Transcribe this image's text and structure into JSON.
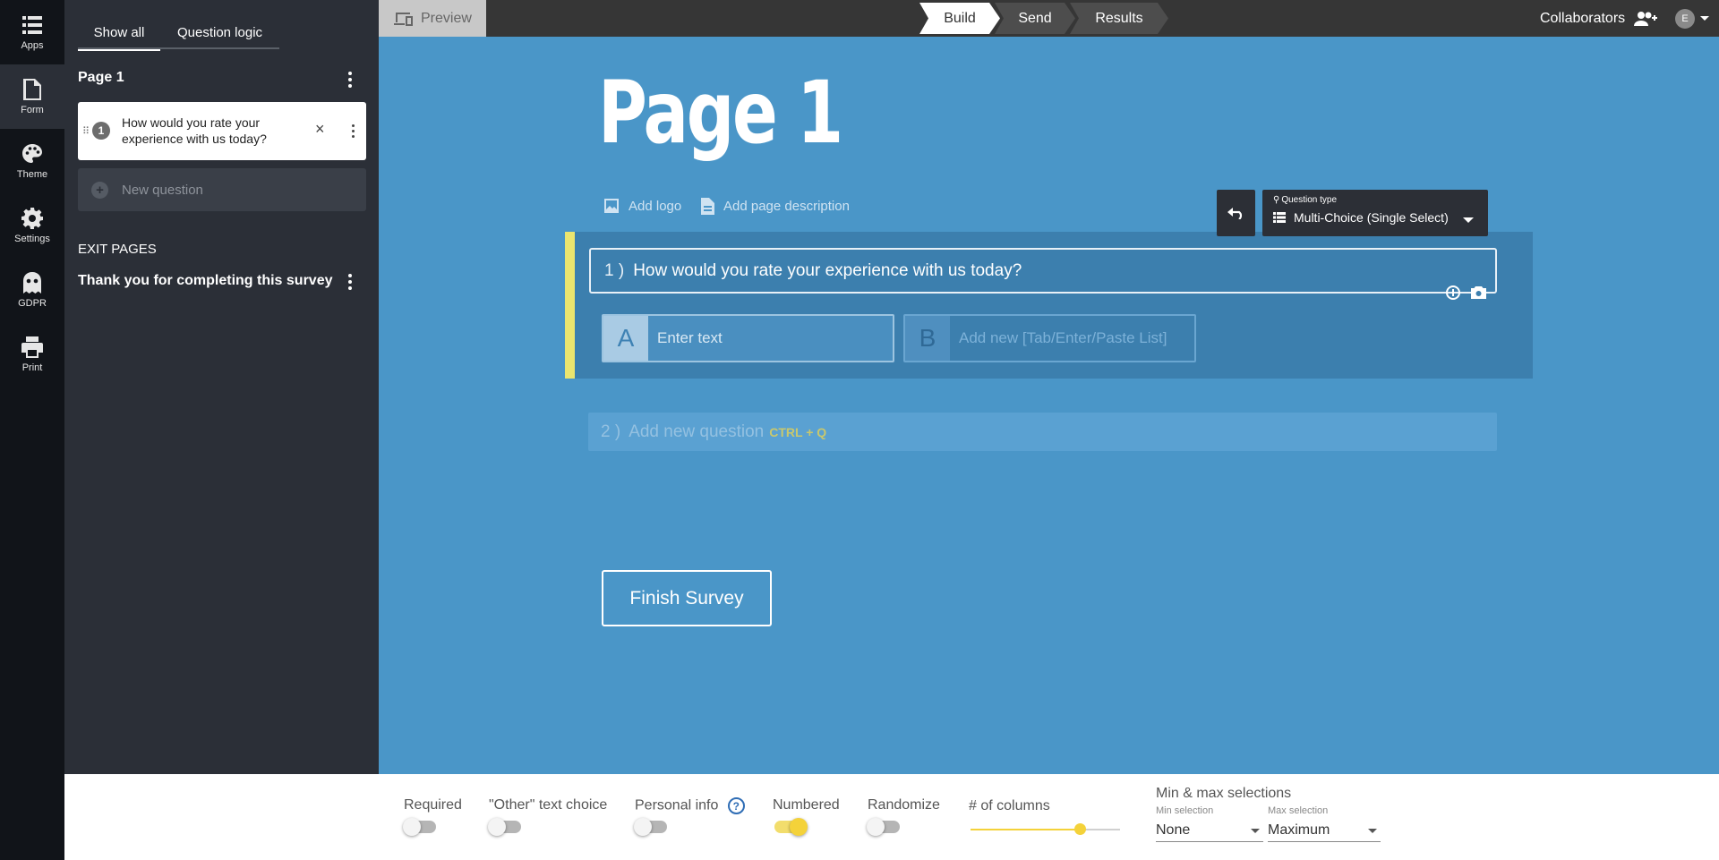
{
  "rail": {
    "items": [
      {
        "label": "Apps",
        "icon": "apps-grid-icon"
      },
      {
        "label": "Form",
        "icon": "document-icon"
      },
      {
        "label": "Theme",
        "icon": "palette-icon"
      },
      {
        "label": "Settings",
        "icon": "gear-icon"
      },
      {
        "label": "GDPR",
        "icon": "ghost-icon"
      },
      {
        "label": "Print",
        "icon": "printer-icon"
      }
    ],
    "active": "Form"
  },
  "panel": {
    "tabs": [
      "Show all",
      "Question logic"
    ],
    "active_tab": "Show all",
    "page_title": "Page 1",
    "questions": [
      {
        "number": "1",
        "text": "How would you rate your experience with us today?"
      }
    ],
    "new_question": "New question",
    "exit_pages_heading": "EXIT PAGES",
    "exit_pages": [
      "Thank you for completing this survey"
    ]
  },
  "topbar": {
    "preview": "Preview",
    "steps": [
      "Build",
      "Send",
      "Results"
    ],
    "active_step": "Build",
    "collaborators": "Collaborators",
    "avatar_initial": "E"
  },
  "canvas": {
    "page_title": "Page 1",
    "add_logo": "Add logo",
    "add_description": "Add page description",
    "question": {
      "number": "1 )",
      "text": "How would you rate your experience with us today?",
      "type_label": "Question type",
      "type_value": "Multi-Choice (Single Select)",
      "choices": [
        {
          "letter": "A",
          "placeholder": "Enter text"
        },
        {
          "letter": "B",
          "placeholder": "Add new [Tab/Enter/Paste List]"
        }
      ]
    },
    "add_question": {
      "number": "2 )",
      "text": "Add new question",
      "shortcut": "CTRL + Q"
    },
    "finish_button": "Finish Survey"
  },
  "options": {
    "required": {
      "label": "Required",
      "on": false
    },
    "other_text": {
      "label": "\"Other\" text choice",
      "on": false
    },
    "personal_info": {
      "label": "Personal info",
      "help": "?",
      "on": false
    },
    "numbered": {
      "label": "Numbered",
      "on": true
    },
    "randomize": {
      "label": "Randomize",
      "on": false
    },
    "columns": {
      "label": "# of columns",
      "slider_fraction": 0.73
    },
    "min_max": {
      "title": "Min & max selections",
      "min_label": "Min selection",
      "min_value": "None",
      "max_label": "Max selection",
      "max_value": "Maximum"
    }
  },
  "colors": {
    "canvas_bg": "#4a96c8",
    "rail_bg": "#111419",
    "panel_bg": "#2b2f37",
    "accent_yellow": "#f4d23a"
  }
}
